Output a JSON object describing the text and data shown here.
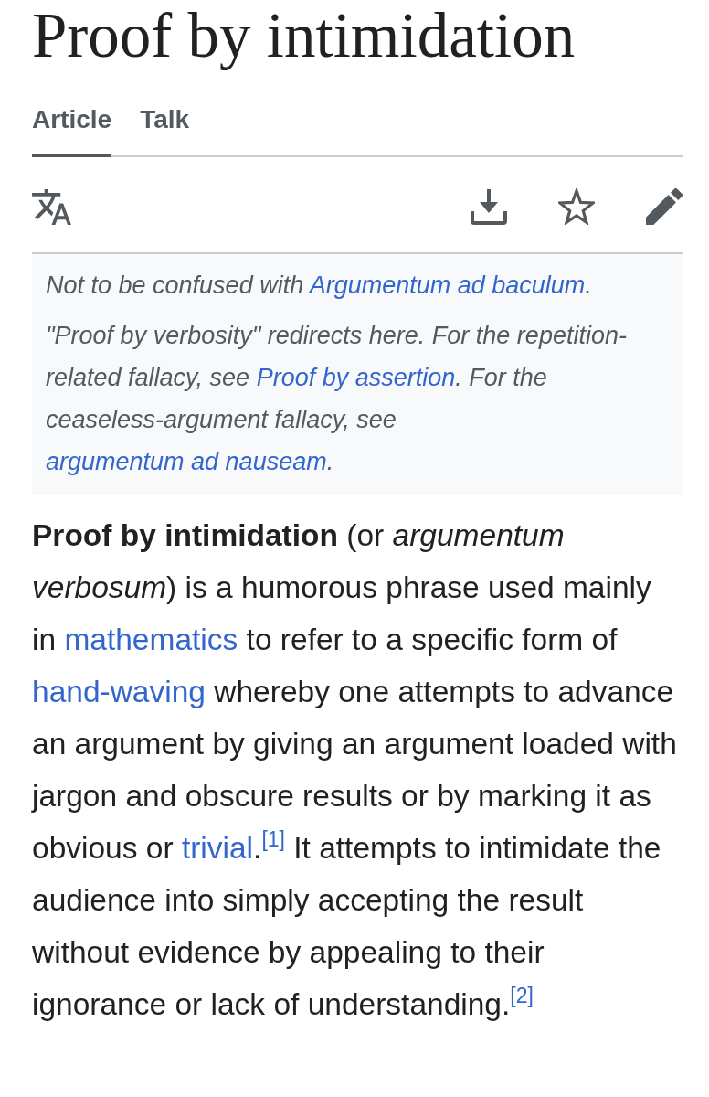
{
  "title": "Proof by intimidation",
  "tabs": [
    {
      "label": "Article",
      "selected": true
    },
    {
      "label": "Talk",
      "selected": false
    }
  ],
  "hatnotes": [
    {
      "segments": [
        {
          "kind": "text",
          "text": "Not to be confused with "
        },
        {
          "kind": "link",
          "text": "Argumentum ad baculum"
        },
        {
          "kind": "text",
          "text": "."
        }
      ]
    },
    {
      "segments": [
        {
          "kind": "text",
          "text": "\"Proof by verbosity\" redirects here. For the repetition-related fallacy, see "
        },
        {
          "kind": "link",
          "text": "Proof by assertion"
        },
        {
          "kind": "text",
          "text": ". For the ceaseless-argument fallacy, see "
        },
        {
          "kind": "link",
          "text": "argumentum ad nauseam"
        },
        {
          "kind": "text",
          "text": "."
        }
      ]
    }
  ],
  "paragraph": [
    {
      "kind": "text",
      "text": "**Proof by intimidation** (or *argumentum verbosum*) is a humorous phrase used mainly in "
    },
    {
      "kind": "link",
      "text": "mathematics"
    },
    {
      "kind": "text",
      "text": " to refer to a specific form of "
    },
    {
      "kind": "link",
      "text": "hand-waving"
    },
    {
      "kind": "text",
      "text": " whereby one attempts to advance an argument by giving an argument loaded with jargon and obscure results or by marking it as obvious or "
    },
    {
      "kind": "link",
      "text": "trivial"
    },
    {
      "kind": "text",
      "text": "."
    },
    {
      "kind": "ref",
      "text": "[1]"
    },
    {
      "kind": "text",
      "text": " It attempts to intimidate the audience into simply accepting the result without evidence by appealing to their ignorance or lack of understanding."
    },
    {
      "kind": "ref",
      "text": "[2]"
    }
  ]
}
